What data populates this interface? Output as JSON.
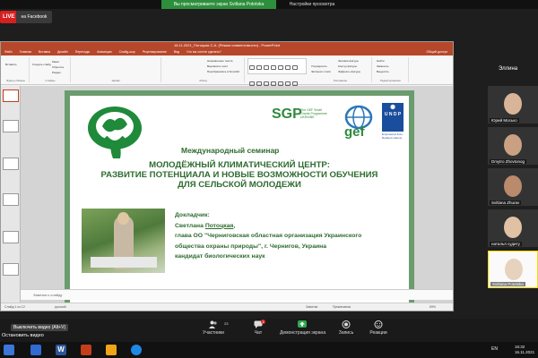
{
  "zoom": {
    "share_banner": "Вы просматриваете экран Svitlana Pototska",
    "view_options": "Настройки просмотра",
    "live": "LIVE",
    "platform": "на Facebook",
    "stop_video": "Остановить видео",
    "tooltip": "Выключить видео (Alt+V)",
    "toolbar": {
      "participants_label": "Участники",
      "participants_count": "23",
      "chat_label": "Чат",
      "chat_badge": "1",
      "share_label": "Демонстрация экрана",
      "record_label": "Запись",
      "reactions_label": "Реакции"
    },
    "participants": [
      {
        "name": "Юрий Мосько"
      },
      {
        "name": "Dmytro Zhovtonog"
      },
      {
        "name": "Svitlana Zhurav"
      },
      {
        "name": "наталья судиту"
      },
      {
        "name": "Svitlana Pototska"
      }
    ],
    "speaker_label": "Эллина"
  },
  "ppt": {
    "window_title": "16.11.2021_Потоцкая С.А. (Режим совместимости) - PowerPoint",
    "tabs": [
      "Файл",
      "Главная",
      "Вставка",
      "Дизайн",
      "Переходы",
      "Анимация",
      "Слайд-шоу",
      "Рецензирование",
      "Вид",
      "Что вы хотите сделать?"
    ],
    "share_button": "Общий доступ",
    "ribbon": {
      "paste": "Вставить",
      "clipboard": "Буфер обмена",
      "create_slide": "Создать слайд",
      "slides": "Слайды",
      "layout": "Макет",
      "reset": "Сбросить",
      "section": "Раздел",
      "font": "Шрифт",
      "paragraph": "Абзац",
      "text_direction": "Направление текста",
      "align_text": "Выровнять текст",
      "smartart": "Преобразовать в SmartArt",
      "drawing": "Рисование",
      "arrange": "Упорядочить",
      "quick_styles": "Экспресс-стили",
      "fill": "Заливка фигуры",
      "outline": "Контур фигуры",
      "effects": "Эффекты фигуры",
      "find": "Найти",
      "replace": "Заменить",
      "select": "Выделить",
      "editing": "Редактирование"
    },
    "notes_placeholder": "Заметки к слайду",
    "status": {
      "slide": "Слайд 1 из 12",
      "language": "русский",
      "notes": "Заметки",
      "comments": "Примечания",
      "zoom": "59%"
    }
  },
  "slide": {
    "intl_seminar": "Международный семинар",
    "title_line1": "МОЛОДЁЖНЫЙ КЛИМАТИЧЕСКИЙ ЦЕНТР:",
    "title_line2": "РАЗВИТИЕ ПОТЕНЦИАЛА И НОВЫЕ ВОЗМОЖНОСТИ ОБУЧЕНИЯ",
    "title_line3": "ДЛЯ СЕЛЬСКОЙ МОЛОДЕЖИ",
    "speaker_heading": "Докладчик:",
    "speaker_name_first": "Светлана ",
    "speaker_name_last": "Потоцкая",
    "speaker_line2": "глава ОО \"Черниговская областная организация Украинского",
    "speaker_line3": "общества охраны природы\", г. Чернигов, Украина",
    "speaker_line4": "кандидат биологических наук",
    "sgp_left": "SGP",
    "sgp_sub": "The GEF Small Grants Programme",
    "sgp_country": "UKRAINE",
    "gef": "gef",
    "undp": "U N D P",
    "undp_caption": "Empowered lives. Resilient nations."
  },
  "taskbar": {
    "lang": "EN",
    "time": "16:32",
    "date": "16.11.2021"
  },
  "colors": {
    "slide_border": "#6b9c6e",
    "title_green": "#2d6b2e",
    "ppt_accent": "#b7472a",
    "zoom_green": "#2d8f3c",
    "live_red": "#d62020"
  }
}
